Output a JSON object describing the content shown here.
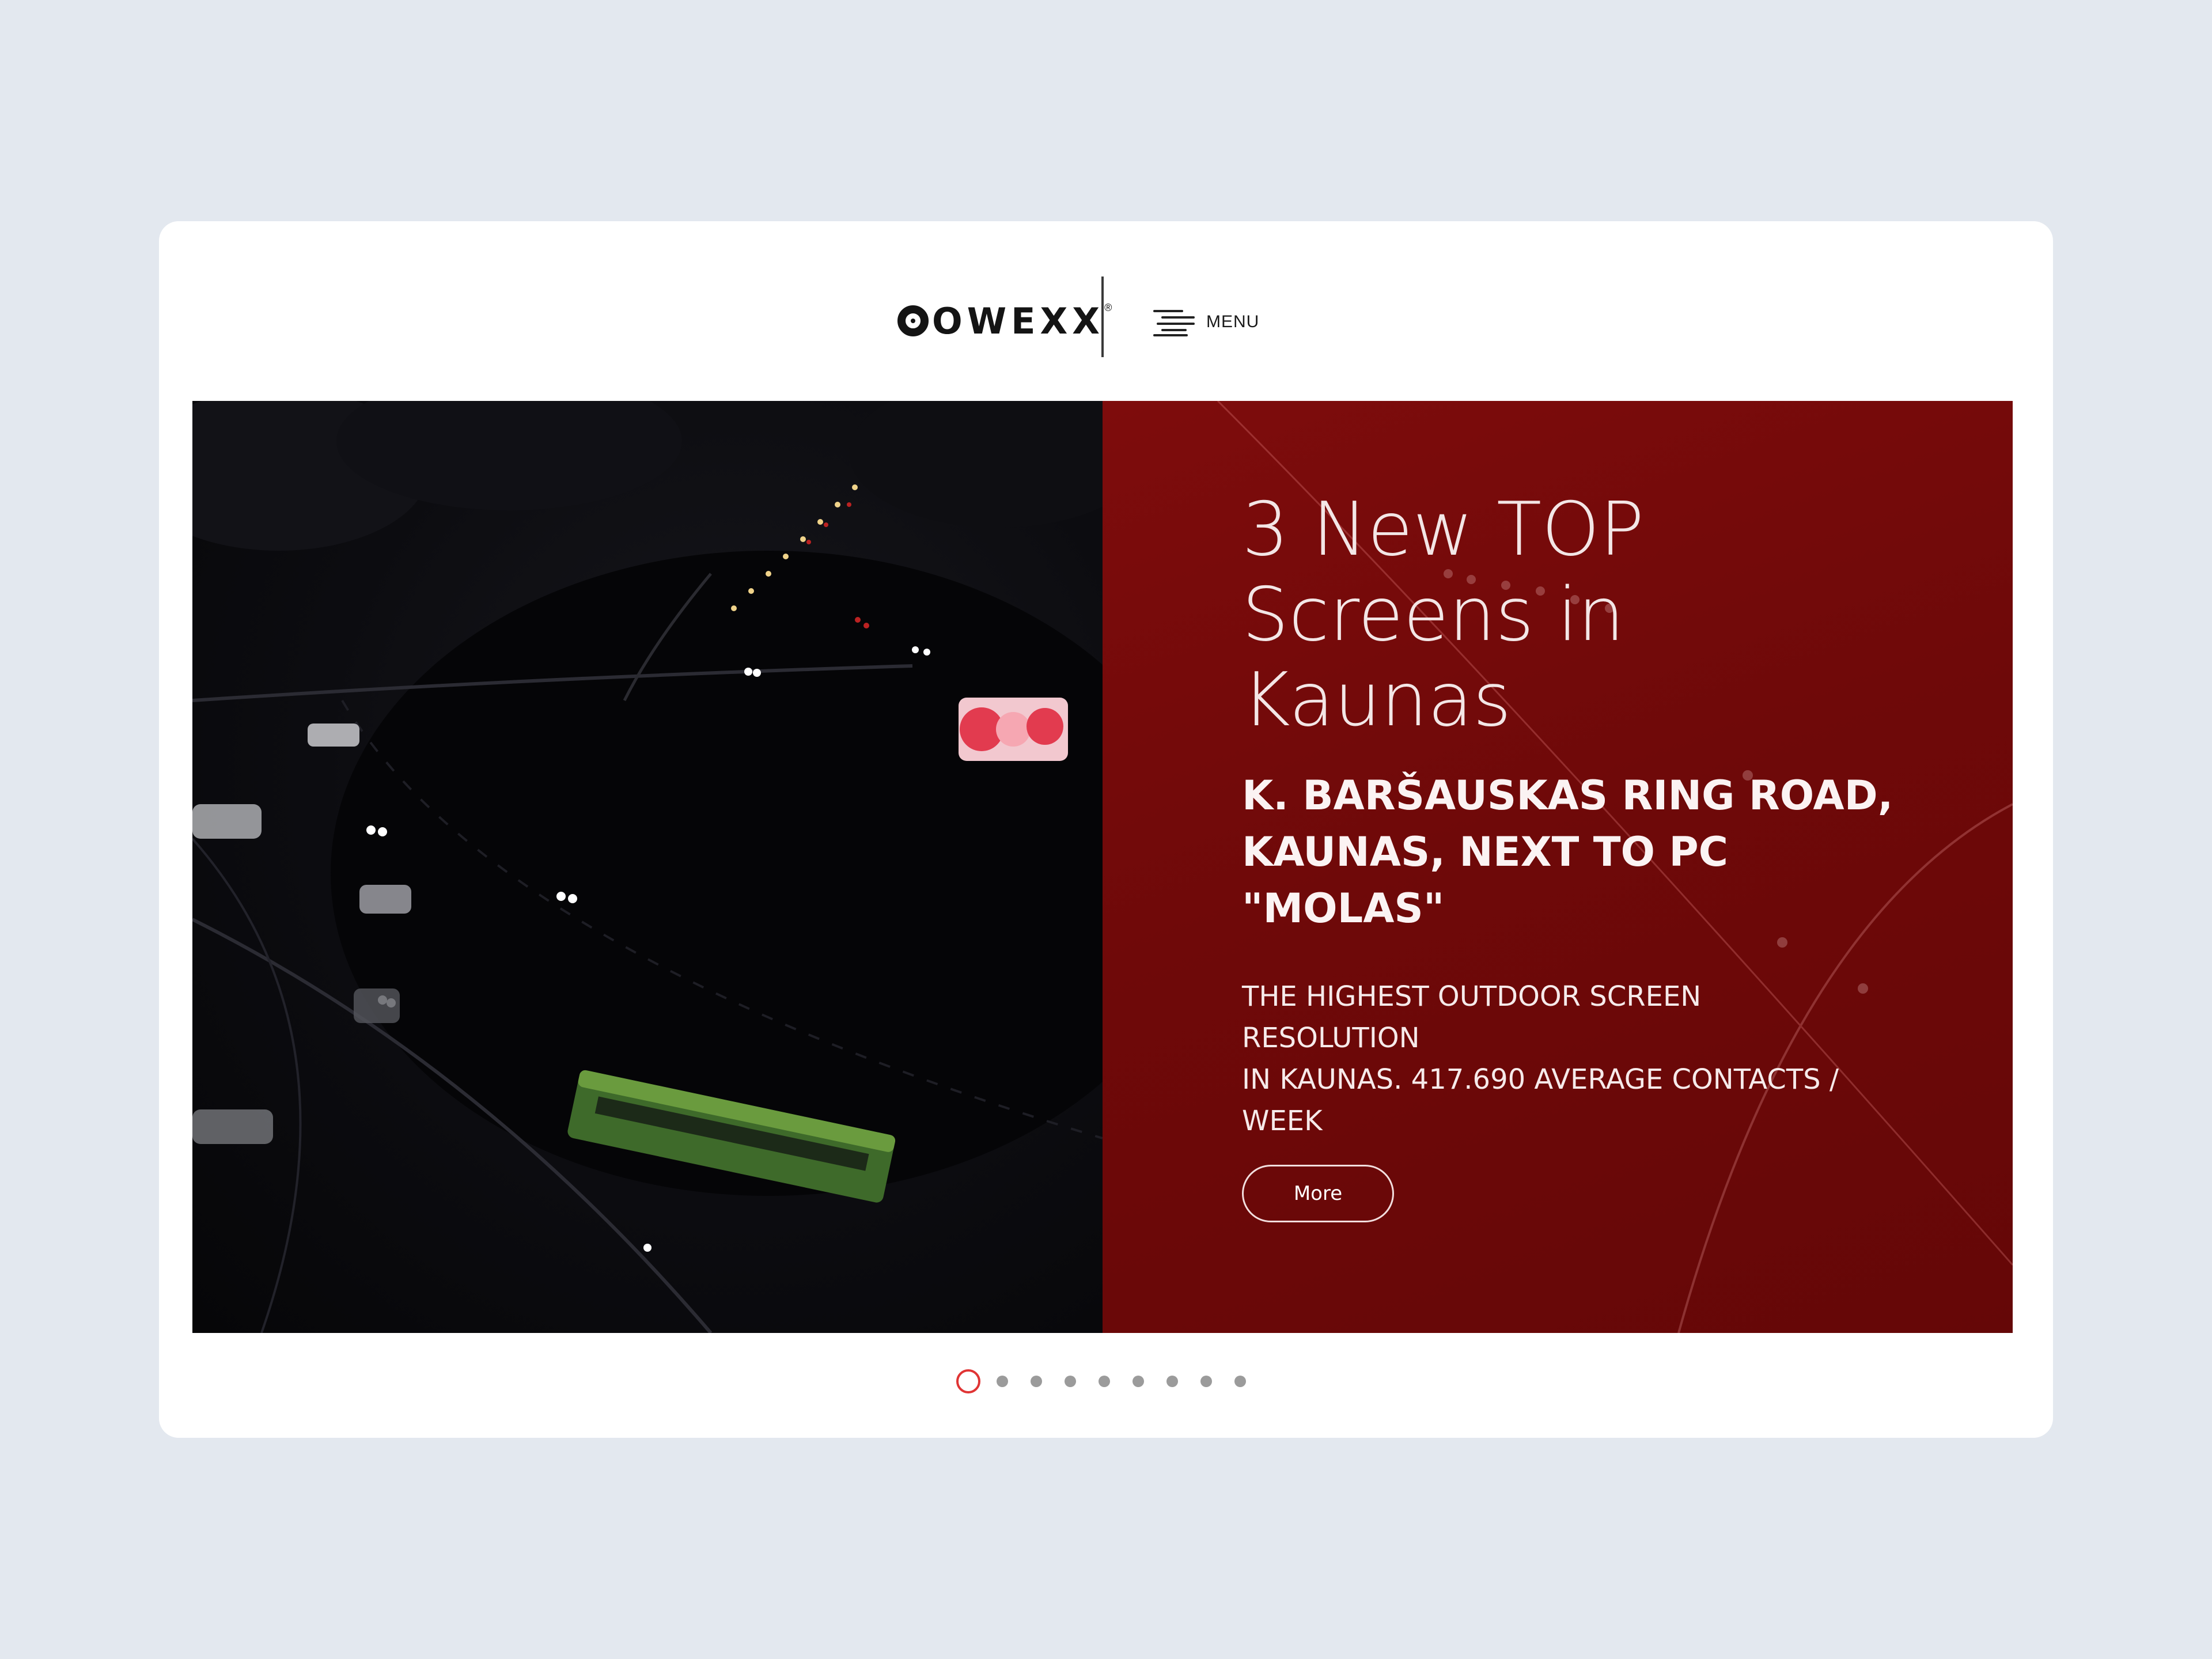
{
  "header": {
    "logo_text": "OWEXX",
    "logo_reg": "®",
    "menu_label": "MENU"
  },
  "slide": {
    "title_lines": [
      "3 New TOP",
      "Screens in",
      "Kaunas"
    ],
    "subtitle_lines": [
      "K. BARŠAUSKAS RING ROAD,",
      "KAUNAS, NEXT TO PC",
      "\"MOLAS\""
    ],
    "description_lines": [
      "THE HIGHEST OUTDOOR SCREEN",
      "RESOLUTION",
      "IN KAUNAS. 417.690 AVERAGE CONTACTS /",
      "WEEK"
    ],
    "more_label": "More",
    "panel_color": "#7a0b0b"
  },
  "pagination": {
    "total": 9,
    "active_index": 0,
    "active_color": "#e03434"
  }
}
